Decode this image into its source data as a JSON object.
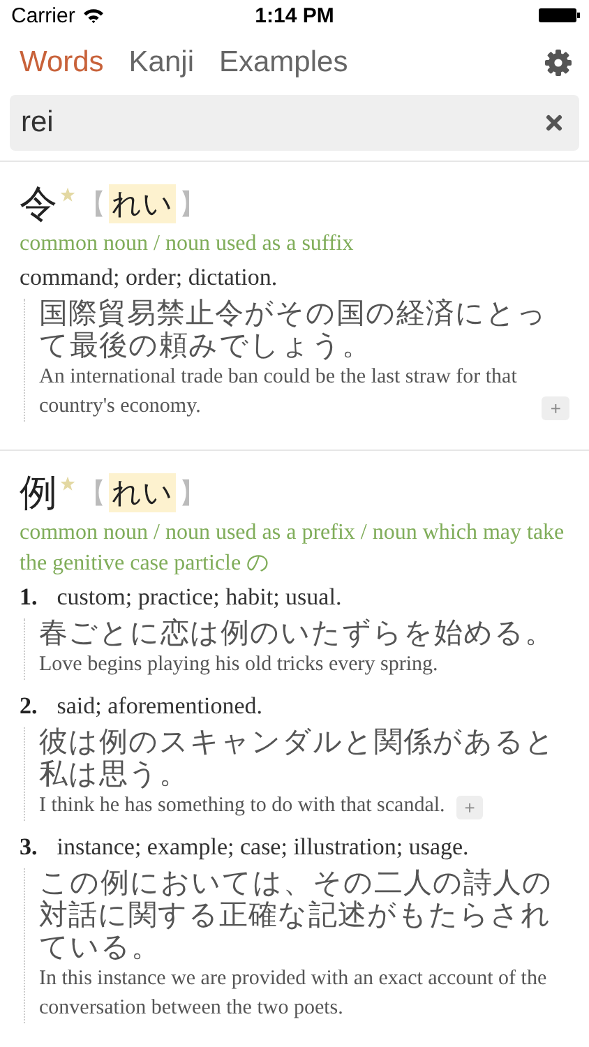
{
  "status_bar": {
    "carrier": "Carrier",
    "time": "1:14 PM"
  },
  "tabs": [
    {
      "label": "Words",
      "selected": true
    },
    {
      "label": "Kanji",
      "selected": false
    },
    {
      "label": "Examples",
      "selected": false
    }
  ],
  "search": {
    "value": "rei"
  },
  "entries": [
    {
      "headword": "令",
      "starred": true,
      "bracket_open": "【",
      "reading": "れい",
      "bracket_close": "】",
      "pos": "common noun / noun used as a suffix",
      "senses": [
        {
          "definition": "command; order; dictation.",
          "examples": [
            {
              "japanese": "国際貿易禁止令がその国の経済にとって最後の頼みでしょう。",
              "english": "An international trade ban could be the last straw for that country's economy.",
              "more": "+"
            }
          ]
        }
      ]
    },
    {
      "headword": "例",
      "starred": true,
      "bracket_open": "【",
      "reading": "れい",
      "bracket_close": "】",
      "pos": "common noun / noun used as a prefix / noun which may take the genitive case particle の",
      "senses": [
        {
          "number": "1.",
          "definition": "custom; practice; habit; usual.",
          "examples": [
            {
              "japanese": "春ごとに恋は例のいたずらを始める。",
              "english": "Love begins playing his old tricks every spring."
            }
          ]
        },
        {
          "number": "2.",
          "definition": "said; aforementioned.",
          "examples": [
            {
              "japanese": "彼は例のスキャンダルと関係があると私は思う。",
              "english": "I think he has something to do with that scandal.",
              "more": "+"
            }
          ]
        },
        {
          "number": "3.",
          "definition": "instance; example; case; illustration; usage.",
          "examples": [
            {
              "japanese": "この例においては、その二人の詩人の対話に関する正確な記述がもたらされている。",
              "english": "In this instance we are provided with an exact account of the conversation between the two poets."
            }
          ]
        }
      ]
    }
  ]
}
